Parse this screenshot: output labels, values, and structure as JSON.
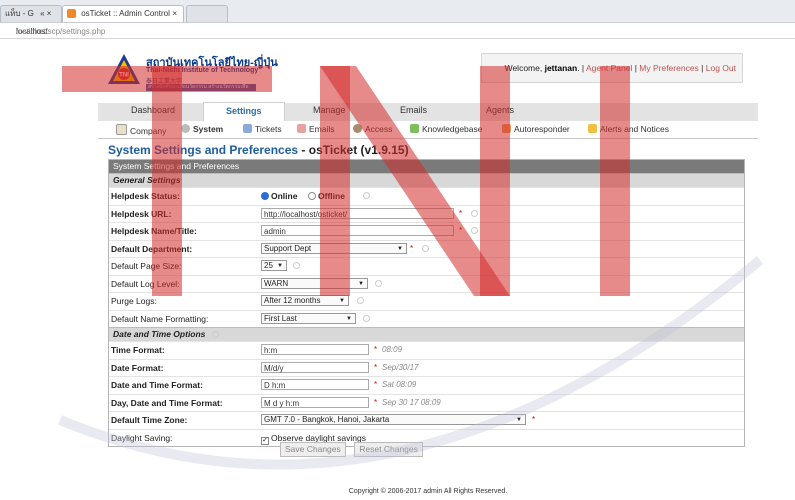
{
  "browser": {
    "tabs": [
      {
        "label": "แท็บ - G",
        "close": "«  ×"
      },
      {
        "label": "osTicket :: Admin Control",
        "close": "×"
      },
      {
        "label": ""
      }
    ],
    "address": {
      "host": "localhost",
      "path": "/osticket/scp/settings.php"
    }
  },
  "header": {
    "logo_th": "สถาบันเทคโนโลยีไทย-ญี่ปุ่น",
    "logo_en": "Thai-Nichi Institute of Technology",
    "logo_jp": "泰日工業大学",
    "logo_bar": "สร้างนักศึกษาเพื่อนวัตกรรม สร้างนวัตกรรมเพื่อสังคม",
    "welcome_prefix": "Welcome,",
    "username": "jettanan",
    "links": [
      "Agent Panel",
      "My Preferences",
      "Log Out"
    ]
  },
  "mainnav": [
    "Dashboard",
    "Settings",
    "Manage",
    "Emails",
    "Agents"
  ],
  "subnav": [
    "Company",
    "System",
    "Tickets",
    "Emails",
    "Access",
    "Knowledgebase",
    "Autoresponder",
    "Alerts and Notices"
  ],
  "page": {
    "title": "System Settings and Preferences",
    "version": "- osTicket (v1.9.15)"
  },
  "form": {
    "header": "System Settings and Preferences",
    "general_section": "General Settings",
    "datetime_section": "Date and Time Options",
    "rows": {
      "status": {
        "label": "Helpdesk Status:",
        "online": "Online",
        "offline": "Offline"
      },
      "url": {
        "label": "Helpdesk URL:",
        "value": "http://localhost/osticket/"
      },
      "name": {
        "label": "Helpdesk Name/Title:",
        "value": "admin"
      },
      "dept": {
        "label": "Default Department:",
        "value": "Support Dept"
      },
      "pagesize": {
        "label": "Default Page Size:",
        "value": "25"
      },
      "loglevel": {
        "label": "Default Log Level:",
        "value": "WARN"
      },
      "purge": {
        "label": "Purge Logs:",
        "value": "After 12 months"
      },
      "nameformat": {
        "label": "Default Name Formatting:",
        "value": "First Last"
      },
      "timefmt": {
        "label": "Time Format:",
        "value": "h:m",
        "hint": "08:09"
      },
      "datefmt": {
        "label": "Date Format:",
        "value": "M/d/y",
        "hint": "Sep/30/17"
      },
      "dtfmt": {
        "label": "Date and Time Format:",
        "value": "D h:m",
        "hint": "Sat 08:09"
      },
      "ddtfmt": {
        "label": "Day, Date and Time Format:",
        "value": "M d y h:m",
        "hint": "Sep 30 17 08:09"
      },
      "timezone": {
        "label": "Default Time Zone:",
        "value": "GMT 7.0 - Bangkok, Hanoi, Jakarta"
      },
      "dst": {
        "label": "Daylight Saving:",
        "value": "Observe daylight savings"
      }
    }
  },
  "buttons": {
    "save": "Save Changes",
    "reset": "Reset Changes"
  },
  "footer": "Copyright © 2006-2017 admin All Rights Reserved.",
  "colors": {
    "accent": "#1d5ea0",
    "watermark": "#d42a2a"
  }
}
